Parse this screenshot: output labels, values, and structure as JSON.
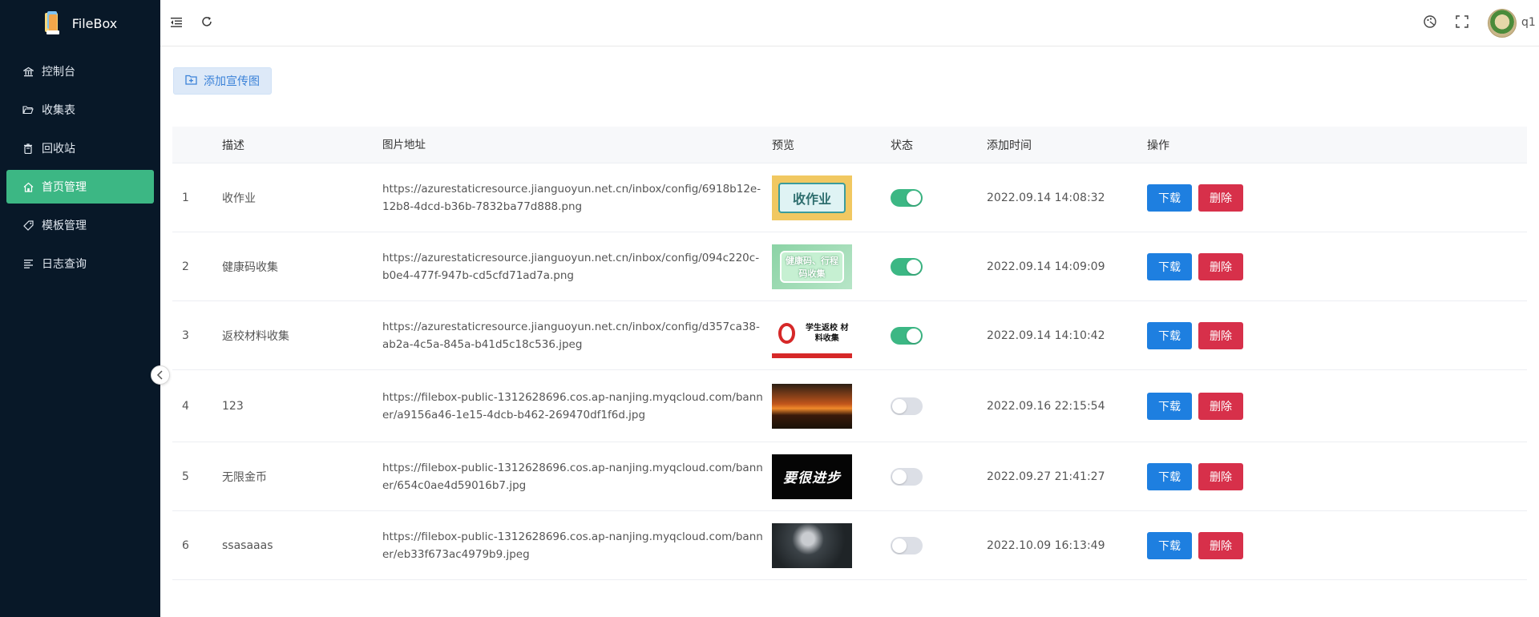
{
  "app": {
    "title": "FileBox"
  },
  "sidebar": {
    "items": [
      {
        "label": "控制台",
        "icon": "bank-icon",
        "active": false
      },
      {
        "label": "收集表",
        "icon": "folder-open-icon",
        "active": false
      },
      {
        "label": "回收站",
        "icon": "trash-icon",
        "active": false
      },
      {
        "label": "首页管理",
        "icon": "home-icon",
        "active": true
      },
      {
        "label": "模板管理",
        "icon": "tag-icon",
        "active": false
      },
      {
        "label": "日志查询",
        "icon": "list-icon",
        "active": false
      }
    ]
  },
  "header": {
    "username": "q1"
  },
  "toolbar": {
    "add_label": "添加宣传图"
  },
  "table": {
    "columns": [
      "描述",
      "图片地址",
      "预览",
      "状态",
      "添加时间",
      "操作"
    ],
    "rows": [
      {
        "index": "1",
        "desc": "收作业",
        "url": "https://azurestaticresource.jianguoyun.net.cn/inbox/config/6918b12e-12b8-4dcd-b36b-7832ba77d888.png",
        "preview_text": "收作业",
        "enabled": true,
        "time": "2022.09.14 14:08:32"
      },
      {
        "index": "2",
        "desc": "健康码收集",
        "url": "https://azurestaticresource.jianguoyun.net.cn/inbox/config/094c220c-b0e4-477f-947b-cd5cfd71ad7a.png",
        "preview_text": "健康码、行程码收集",
        "enabled": true,
        "time": "2022.09.14 14:09:09"
      },
      {
        "index": "3",
        "desc": "返校材料收集",
        "url": "https://azurestaticresource.jianguoyun.net.cn/inbox/config/d357ca38-ab2a-4c5a-845a-b41d5c18c536.jpeg",
        "preview_text": "学生返校 材料收集",
        "enabled": true,
        "time": "2022.09.14 14:10:42"
      },
      {
        "index": "4",
        "desc": "123",
        "url": "https://filebox-public-1312628696.cos.ap-nanjing.myqcloud.com/banner/a9156a46-1e15-4dcb-b462-269470df1f6d.jpg",
        "preview_text": "",
        "enabled": false,
        "time": "2022.09.16 22:15:54"
      },
      {
        "index": "5",
        "desc": "无限金币",
        "url": "https://filebox-public-1312628696.cos.ap-nanjing.myqcloud.com/banner/654c0ae4d59016b7.jpg",
        "preview_text": "要很进步",
        "enabled": false,
        "time": "2022.09.27 21:41:27"
      },
      {
        "index": "6",
        "desc": "ssasaaas",
        "url": "https://filebox-public-1312628696.cos.ap-nanjing.myqcloud.com/banner/eb33f673ac4979b9.jpeg",
        "preview_text": "",
        "enabled": false,
        "time": "2022.10.09 16:13:49"
      }
    ],
    "download_label": "下载",
    "delete_label": "删除"
  },
  "colors": {
    "sidebar_bg": "#081828",
    "active": "#3cb784",
    "primary": "#1e7fe0",
    "danger": "#d7304a"
  }
}
